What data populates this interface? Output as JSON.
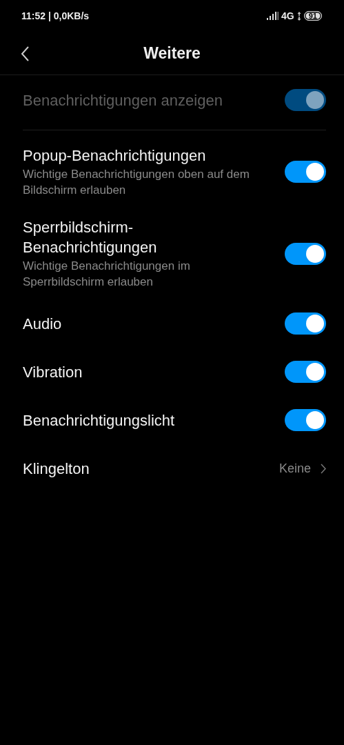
{
  "status_bar": {
    "time": "11:52 | 0,0KB/s",
    "network": "4G",
    "battery": "91"
  },
  "header": {
    "title": "Weitere"
  },
  "master": {
    "title": "Benachrichtigungen anzeigen",
    "on": true,
    "disabled": true
  },
  "settings": [
    {
      "kind": "toggle",
      "title": "Popup-Benachrichtigungen",
      "subtitle": "Wichtige Benachrichtigungen oben auf dem Bildschirm erlauben",
      "on": true
    },
    {
      "kind": "toggle",
      "title": "Sperrbildschirm-Benachrichtigungen",
      "subtitle": "Wichtige Benachrichtigungen im Sperrbildschirm erlauben",
      "on": true
    },
    {
      "kind": "toggle",
      "title": "Audio",
      "on": true
    },
    {
      "kind": "toggle",
      "title": "Vibration",
      "on": true
    },
    {
      "kind": "toggle",
      "title": "Benachrichtigungslicht",
      "on": true
    },
    {
      "kind": "value",
      "title": "Klingelton",
      "value": "Keine"
    }
  ]
}
